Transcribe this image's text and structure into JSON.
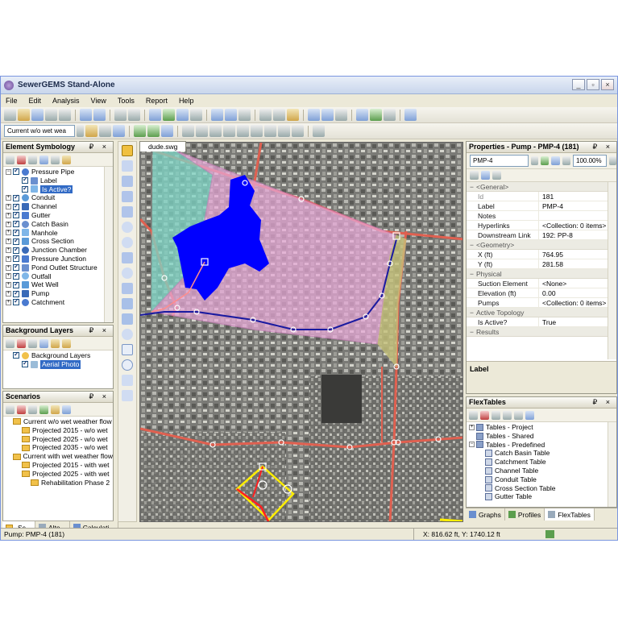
{
  "window": {
    "title": "SewerGEMS Stand-Alone",
    "buttons": [
      "_",
      "▫",
      "×"
    ]
  },
  "menu": [
    "File",
    "Edit",
    "Analysis",
    "View",
    "Tools",
    "Report",
    "Help"
  ],
  "scenario_combo": "Current w/o wet wea",
  "document_tab": "dude.swg",
  "element_symbology": {
    "title": "Element Symbology",
    "items": [
      {
        "label": "Pressure Pipe",
        "expand": "−",
        "level": 0
      },
      {
        "label": "Label",
        "level": 1
      },
      {
        "label": "Is Active?",
        "level": 1,
        "selected": true
      },
      {
        "label": "Conduit",
        "expand": "+",
        "level": 0
      },
      {
        "label": "Channel",
        "expand": "+",
        "level": 0
      },
      {
        "label": "Gutter",
        "expand": "+",
        "level": 0
      },
      {
        "label": "Catch Basin",
        "expand": "+",
        "level": 0
      },
      {
        "label": "Manhole",
        "expand": "+",
        "level": 0
      },
      {
        "label": "Cross Section",
        "expand": "+",
        "level": 0
      },
      {
        "label": "Junction Chamber",
        "expand": "+",
        "level": 0
      },
      {
        "label": "Pressure Junction",
        "expand": "+",
        "level": 0
      },
      {
        "label": "Pond Outlet Structure",
        "expand": "+",
        "level": 0
      },
      {
        "label": "Outfall",
        "expand": "+",
        "level": 0
      },
      {
        "label": "Wet Well",
        "expand": "+",
        "level": 0
      },
      {
        "label": "Pump",
        "expand": "+",
        "level": 0
      },
      {
        "label": "Catchment",
        "expand": "+",
        "level": 0
      }
    ]
  },
  "background_layers": {
    "title": "Background Layers",
    "items": [
      {
        "label": "Background Layers",
        "level": 0
      },
      {
        "label": "Aerial Photo",
        "level": 1,
        "selected": true
      }
    ]
  },
  "scenarios": {
    "title": "Scenarios",
    "items": [
      {
        "label": "Current w/o wet weather flow",
        "level": 0
      },
      {
        "label": "Projected 2015 - w/o wet",
        "level": 1
      },
      {
        "label": "Projected 2025 - w/o wet",
        "level": 1
      },
      {
        "label": "Projected 2035 - w/o wet",
        "level": 1
      },
      {
        "label": "Current with wet weather flow",
        "level": 0
      },
      {
        "label": "Projected 2015 - with wet",
        "level": 1
      },
      {
        "label": "Projected 2025 - with wet",
        "level": 1
      },
      {
        "label": "Rehabilitation Phase 2",
        "level": 2
      }
    ],
    "tabs": [
      "Sc...",
      "Alte...",
      "Calculati..."
    ]
  },
  "properties": {
    "title": "Properties - Pump - PMP-4 (181)",
    "element_combo": "PMP-4",
    "zoom": "100.00%",
    "categories": [
      {
        "name": "<General>",
        "rows": [
          {
            "k": "Id",
            "v": "181",
            "gray": true
          },
          {
            "k": "Label",
            "v": "PMP-4"
          },
          {
            "k": "Notes",
            "v": ""
          },
          {
            "k": "Hyperlinks",
            "v": "<Collection: 0 items>"
          },
          {
            "k": "Downstream Link",
            "v": "192: PP-8"
          }
        ]
      },
      {
        "name": "<Geometry>",
        "rows": [
          {
            "k": "X (ft)",
            "v": "764.95"
          },
          {
            "k": "Y (ft)",
            "v": "281.58"
          }
        ]
      },
      {
        "name": "Physical",
        "rows": [
          {
            "k": "Suction Element",
            "v": "<None>"
          },
          {
            "k": "Elevation (ft)",
            "v": "0.00"
          },
          {
            "k": "Pumps",
            "v": "<Collection: 0 items>"
          }
        ]
      },
      {
        "name": "Active Topology",
        "rows": [
          {
            "k": "Is Active?",
            "v": "True"
          }
        ]
      },
      {
        "name": "Results",
        "rows": []
      }
    ],
    "description_label": "Label"
  },
  "flextables": {
    "title": "FlexTables",
    "items": [
      {
        "label": "Tables - Project",
        "level": 0,
        "expand": "+"
      },
      {
        "label": "Tables - Shared",
        "level": 0
      },
      {
        "label": "Tables - Predefined",
        "level": 0,
        "expand": "−"
      },
      {
        "label": "Catch Basin Table",
        "level": 1
      },
      {
        "label": "Catchment Table",
        "level": 1
      },
      {
        "label": "Channel Table",
        "level": 1
      },
      {
        "label": "Conduit Table",
        "level": 1
      },
      {
        "label": "Cross Section Table",
        "level": 1
      },
      {
        "label": "Gutter Table",
        "level": 1
      }
    ],
    "tabs": [
      "Graphs",
      "Profiles",
      "FlexTables"
    ]
  },
  "status": {
    "left": "Pump:  PMP-4 (181)",
    "coords": "X: 816.62 ft, Y: 1740.12 ft"
  },
  "colors": {
    "accent": "#0066cc",
    "map_polygon_pink": "#e8a8d8",
    "map_polygon_teal": "#7fd6c6",
    "map_polygon_olive": "#c6c27a",
    "map_pipe_blue": "#1a1aa0",
    "map_road_red": "#e06050",
    "map_water": "#0000ff"
  }
}
